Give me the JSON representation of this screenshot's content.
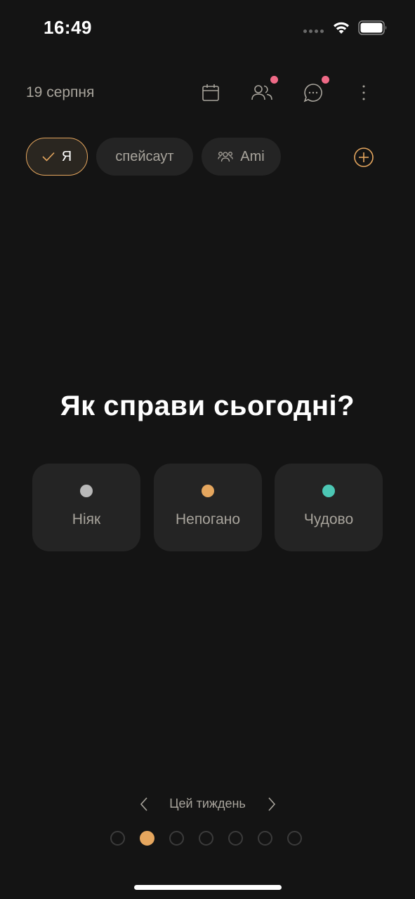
{
  "status_bar": {
    "time": "16:49"
  },
  "header": {
    "date": "19 серпня",
    "icons": [
      "calendar-icon",
      "friends-icon",
      "chat-icon",
      "more-icon"
    ],
    "badge_color": "#ef6a87"
  },
  "profiles": {
    "items": [
      {
        "label": "Я",
        "active": true,
        "icon": "check-icon"
      },
      {
        "label": "спейсаут",
        "active": false,
        "icon": ""
      },
      {
        "label": "Ami",
        "active": false,
        "icon": "group-icon"
      }
    ],
    "add_icon": "plus-circle-icon"
  },
  "main": {
    "question": "Як справи сьогодні?",
    "moods": [
      {
        "label": "Ніяк",
        "color": "#b8b8b8"
      },
      {
        "label": "Непогано",
        "color": "#e5a65e"
      },
      {
        "label": "Чудово",
        "color": "#4cc7b4"
      }
    ]
  },
  "week": {
    "label": "Цей тиждень",
    "pages": 7,
    "active_page": 2
  },
  "colors": {
    "background": "#141414",
    "card": "#242424",
    "accent": "#e5a65e",
    "muted_text": "#a8a49c"
  }
}
